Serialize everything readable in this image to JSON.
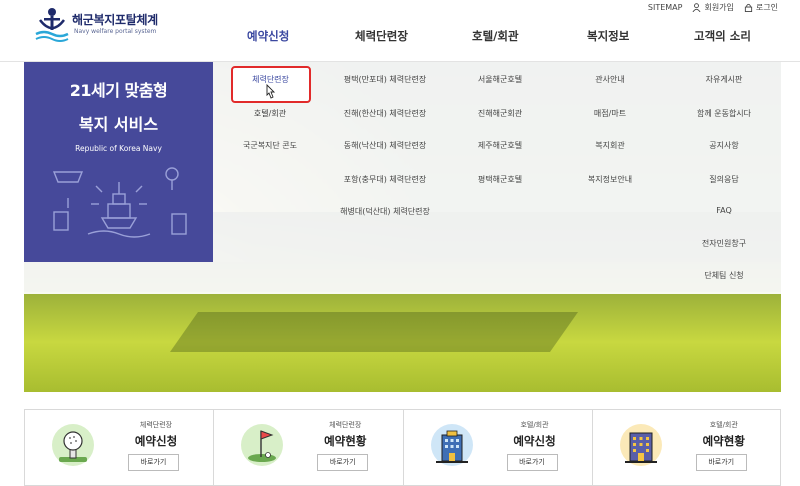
{
  "header": {
    "logo_title": "해군복지포탈체계",
    "logo_sub": "Navy welfare portal system",
    "util": {
      "sitemap": "SITEMAP",
      "join": "회원가입",
      "login": "로그인"
    }
  },
  "gnb": [
    {
      "label": "예약신청",
      "active": true
    },
    {
      "label": "체력단련장",
      "active": false
    },
    {
      "label": "호텔/회관",
      "active": false
    },
    {
      "label": "복지정보",
      "active": false
    },
    {
      "label": "고객의 소리",
      "active": false
    }
  ],
  "promo": {
    "title1": "21세기 맞춤형",
    "title2": "복지 서비스",
    "sub": "Republic of Korea Navy"
  },
  "mega_menu": {
    "col1": [
      "체력단련장",
      "호텔/회관",
      "국군복지단 콘도"
    ],
    "col2": [
      "평택(만포대) 체력단련장",
      "진해(한산대) 체력단련장",
      "동해(낙산대) 체력단련장",
      "포항(충무대) 체력단련장",
      "해병대(덕산대) 체력단련장"
    ],
    "col3": [
      "서울해군호텔",
      "진해해군회관",
      "제주해군호텔",
      "평택해군호텔"
    ],
    "col4": [
      "관사안내",
      "매점/마트",
      "복지회관",
      "복지정보안내"
    ],
    "col5": [
      "자유게시판",
      "함께 운동합시다",
      "공지사항",
      "질의응답",
      "FAQ",
      "전자민원창구",
      "단체팀 신청"
    ]
  },
  "quick": [
    {
      "category": "체력단련장",
      "title": "예약신청",
      "button": "바로가기",
      "icon": "golf-ball-icon"
    },
    {
      "category": "체력단련장",
      "title": "예약현황",
      "button": "바로가기",
      "icon": "golf-flag-icon"
    },
    {
      "category": "호텔/회관",
      "title": "예약신청",
      "button": "바로가기",
      "icon": "hotel-building-icon"
    },
    {
      "category": "호텔/회관",
      "title": "예약현황",
      "button": "바로가기",
      "icon": "hotel-building-icon"
    }
  ],
  "colors": {
    "brand": "#3b48a0",
    "promo_bg": "#46499a",
    "highlight": "#e12a2a"
  }
}
